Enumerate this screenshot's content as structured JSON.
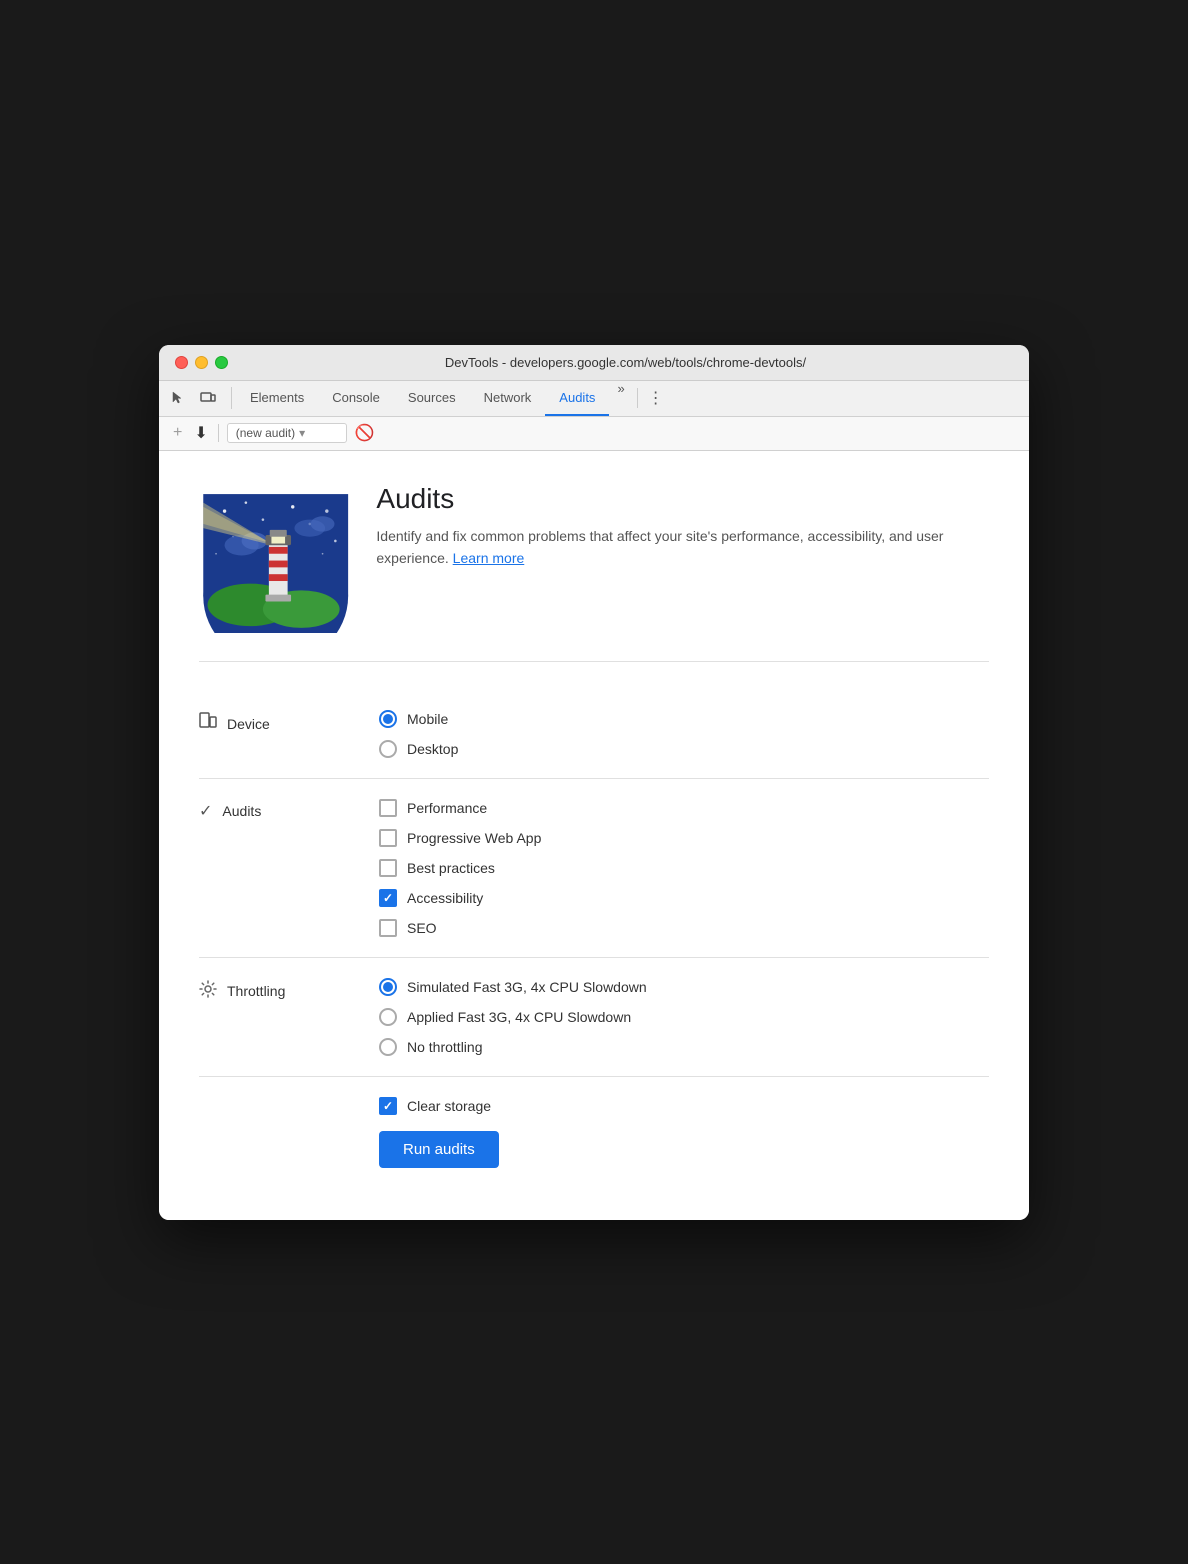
{
  "window": {
    "title": "DevTools - developers.google.com/web/tools/chrome-devtools/"
  },
  "tabs": [
    {
      "id": "elements",
      "label": "Elements",
      "active": false
    },
    {
      "id": "console",
      "label": "Console",
      "active": false
    },
    {
      "id": "sources",
      "label": "Sources",
      "active": false
    },
    {
      "id": "network",
      "label": "Network",
      "active": false
    },
    {
      "id": "audits",
      "label": "Audits",
      "active": true
    }
  ],
  "toolbar": {
    "audit_select": "(new audit)",
    "audit_placeholder": "(new audit)"
  },
  "header": {
    "title": "Audits",
    "description": "Identify and fix common problems that affect your site's performance, accessibility, and user experience.",
    "learn_more": "Learn more"
  },
  "device_section": {
    "label": "Device",
    "options": [
      {
        "id": "mobile",
        "label": "Mobile",
        "checked": true
      },
      {
        "id": "desktop",
        "label": "Desktop",
        "checked": false
      }
    ]
  },
  "audits_section": {
    "label": "Audits",
    "options": [
      {
        "id": "performance",
        "label": "Performance",
        "checked": false
      },
      {
        "id": "pwa",
        "label": "Progressive Web App",
        "checked": false
      },
      {
        "id": "best_practices",
        "label": "Best practices",
        "checked": false
      },
      {
        "id": "accessibility",
        "label": "Accessibility",
        "checked": true
      },
      {
        "id": "seo",
        "label": "SEO",
        "checked": false
      }
    ]
  },
  "throttling_section": {
    "label": "Throttling",
    "options": [
      {
        "id": "simulated",
        "label": "Simulated Fast 3G, 4x CPU Slowdown",
        "checked": true
      },
      {
        "id": "applied",
        "label": "Applied Fast 3G, 4x CPU Slowdown",
        "checked": false
      },
      {
        "id": "none",
        "label": "No throttling",
        "checked": false
      }
    ]
  },
  "storage": {
    "label": "Clear storage",
    "checked": true
  },
  "run_button": "Run audits"
}
